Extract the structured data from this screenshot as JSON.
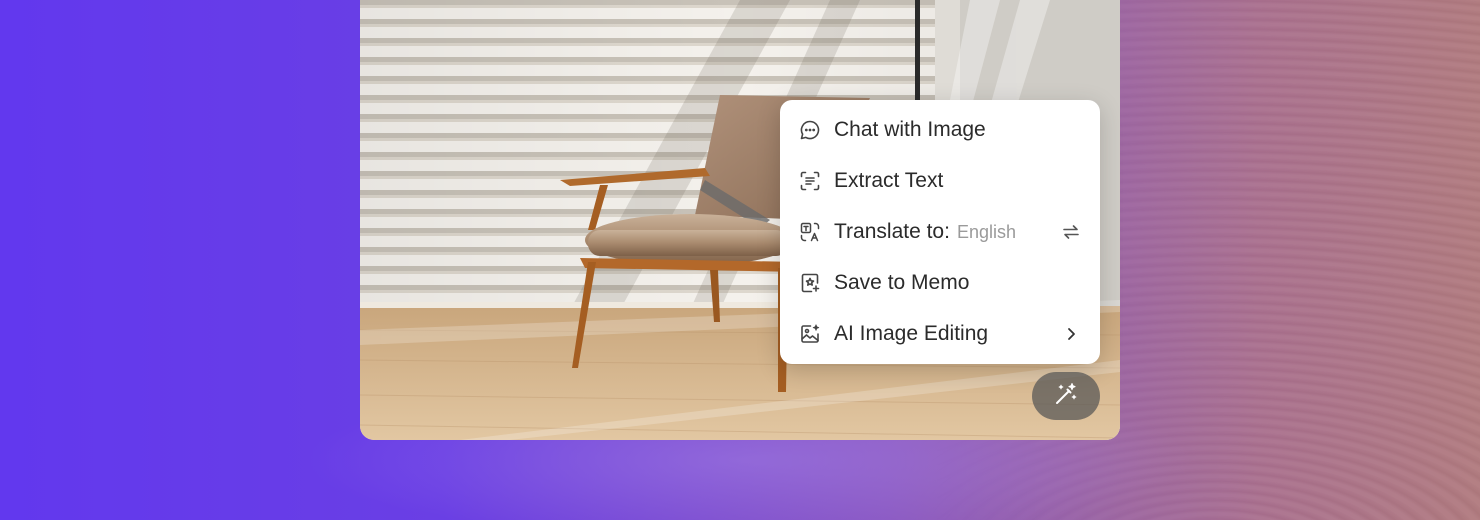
{
  "menu": {
    "items": [
      {
        "label": "Chat with Image",
        "icon": "chat-bubble-icon"
      },
      {
        "label": "Extract Text",
        "icon": "text-scan-icon"
      },
      {
        "label": "Translate to:",
        "sub": "English",
        "icon": "translate-icon",
        "trail_icon": "swap-icon"
      },
      {
        "label": "Save to Memo",
        "icon": "save-memo-icon"
      },
      {
        "label": "AI Image Editing",
        "icon": "ai-image-icon",
        "trail_icon": "chevron-right-icon"
      }
    ]
  },
  "magic_button": {
    "icon": "magic-wand-icon"
  },
  "colors": {
    "background_left": "#6238ee",
    "background_right": "#b07a7e",
    "menu_bg": "#ffffff",
    "menu_text": "#2b2b2b",
    "menu_subtext": "#9a9a9a",
    "icon_stroke": "#444444"
  }
}
